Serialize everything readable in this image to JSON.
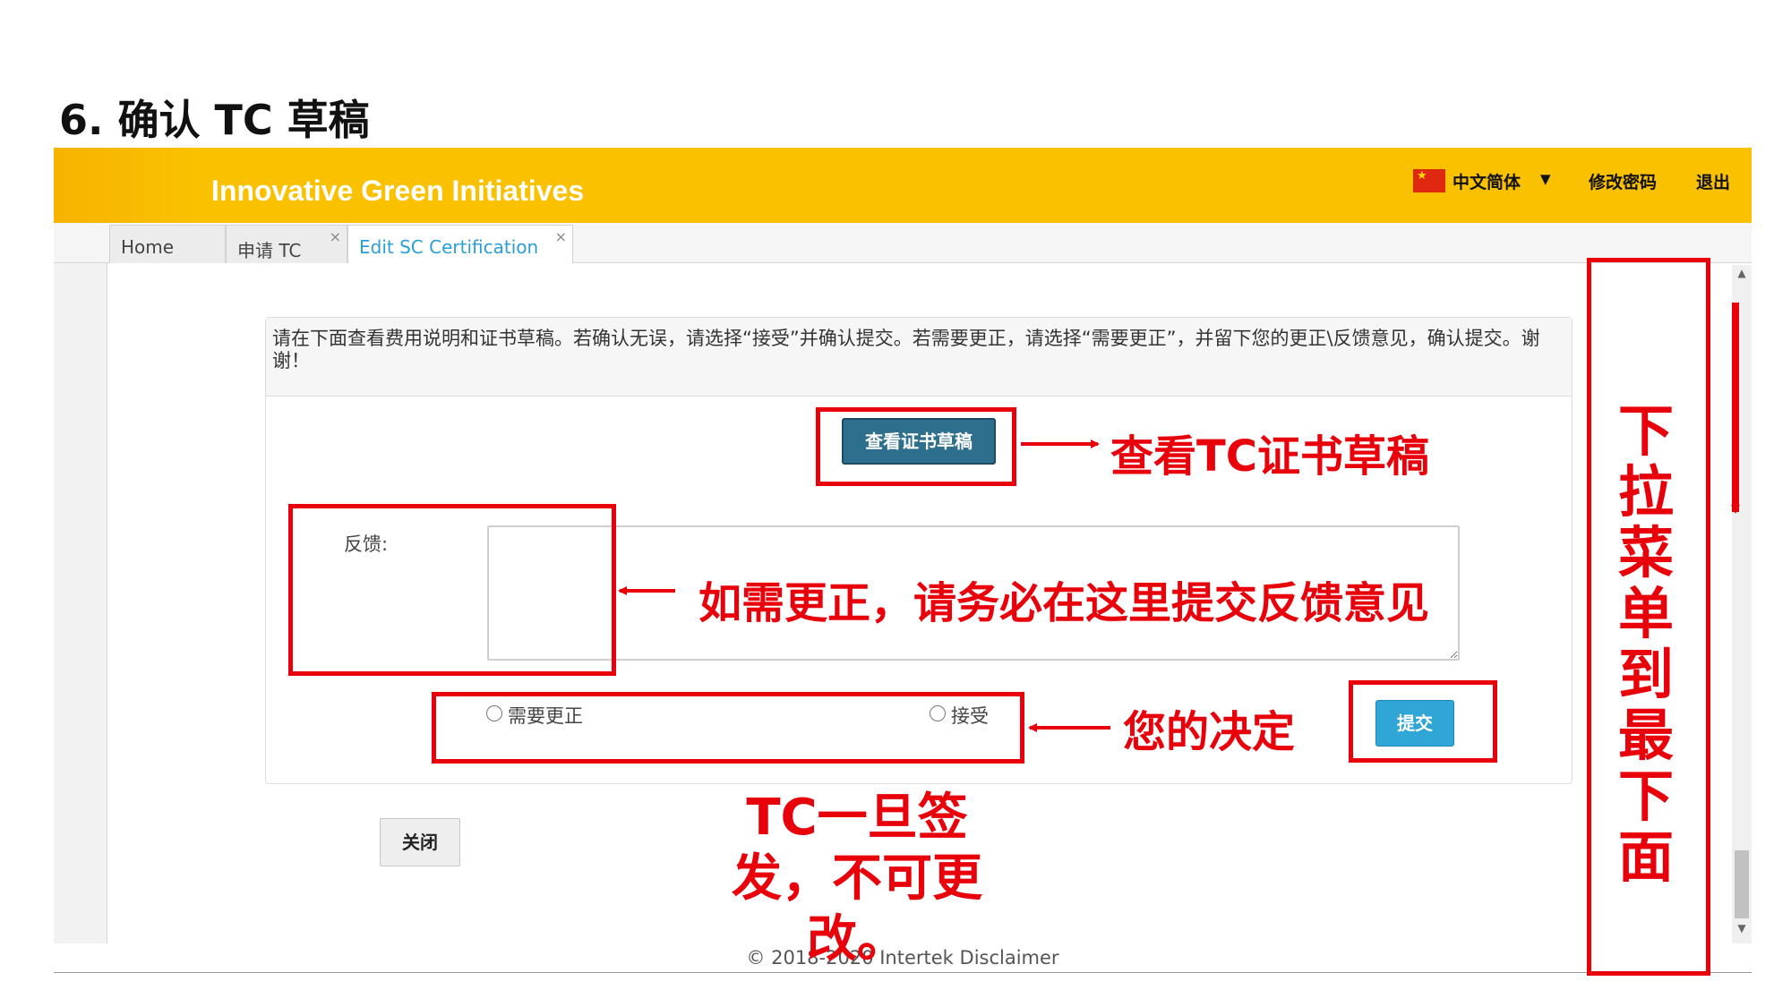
{
  "slide": {
    "title": "6. 确认 TC 草稿"
  },
  "header": {
    "app_name": "Innovative Green Initiatives",
    "language": "中文简体",
    "change_password": "修改密码",
    "logout": "退出",
    "accent_color": "#f9c100"
  },
  "tabs": [
    {
      "label": "Home",
      "active": false,
      "closable": false
    },
    {
      "label": "申请 TC",
      "active": false,
      "closable": true
    },
    {
      "label": "Edit SC Certification",
      "active": true,
      "closable": true
    }
  ],
  "tab_close_glyph": "×",
  "form": {
    "instruction": "请在下面查看费用说明和证书草稿。若确认无误，请选择“接受”并确认提交。若需要更正，请选择“需要更正”，并留下您的更正\\反馈意见，确认提交。谢谢！",
    "view_draft_button": "查看证书草稿",
    "feedback_label": "反馈:",
    "feedback_value": "",
    "options": [
      {
        "label": "需要更正",
        "checked": false
      },
      {
        "label": "接受",
        "checked": false
      }
    ],
    "submit_button": "提交",
    "close_button": "关闭"
  },
  "footer": {
    "text": "© 2018-2020 Intertek Disclaimer"
  },
  "annotations": {
    "view_draft": "查看TC证书草稿",
    "feedback": "如需更正，请务必在这里提交反馈意见",
    "decision": "您的决定",
    "issued_note": "TC一旦签发，不可更改。",
    "scroll_note": "下拉菜单到最下面",
    "color": "#e8000a"
  }
}
